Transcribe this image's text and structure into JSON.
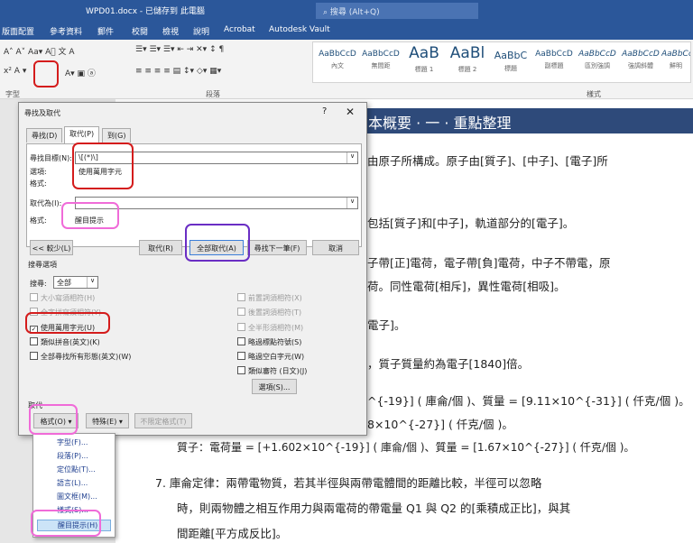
{
  "titlebar": {
    "document": "WPD01.docx - 已儲存到 此電腦",
    "search_placeholder": "搜尋 (Alt+Q)"
  },
  "menu_tabs": [
    "版面配置",
    "參考資料",
    "郵件",
    "校閱",
    "檢視",
    "說明",
    "Acrobat",
    "Autodesk Vault"
  ],
  "ribbon": {
    "font_group": "字型",
    "paragraph_group": "段落",
    "styles_group": "樣式",
    "styles": [
      {
        "preview": "AaBbCcD",
        "name": "內文"
      },
      {
        "preview": "AaBbCcD",
        "name": "無間距"
      },
      {
        "preview": "AaB",
        "name": "標題 1"
      },
      {
        "preview": "AaBl",
        "name": "標題 2"
      },
      {
        "preview": "AaBbC",
        "name": "標題"
      },
      {
        "preview": "AaBbCcD",
        "name": "副標題"
      },
      {
        "preview": "AaBbCcD",
        "name": "區別強調"
      },
      {
        "preview": "AaBbCcD",
        "name": "強調斜體"
      },
      {
        "preview": "AaBbCcD",
        "name": "鮮明"
      }
    ]
  },
  "document": {
    "banner": "本概要 · 一 · 重點整理",
    "lines": [
      "由原子所構成。原子由[質子]、[中子]、[電子]所",
      "包括[質子]和[中子]，軌道部分的[電子]。",
      "子帶[正]電荷，電子帶[負]電荷，中子不帶電，原",
      "荷。同性電荷[相斥]，異性電荷[相吸]。",
      "電子]。",
      "，質子質量約為電子[1840]倍。",
      "^{-19}] ( 庫侖/個 )、質量 = [9.11×10^{-31}] ( 仟克/個 )。",
      "8×10^{-27}] ( 仟克/個 )。",
      "質子：電荷量 = [+1.602×10^{-19}] ( 庫侖/個 )、質量 = [1.67×10^{-27}] ( 仟克/個 )。",
      "7. 庫侖定律：兩帶電物質，若其半徑與兩帶電體間的距離比較，半徑可以忽略",
      "時，則兩物體之相互作用力與兩電荷的帶電量 Q1 與 Q2 的[乘積成正比]，與其",
      "間距離[平方成反比]。"
    ]
  },
  "dialog": {
    "title": "尋找及取代",
    "help": "?",
    "close": "✕",
    "tabs": [
      "尋找(D)",
      "取代(P)",
      "到(G)"
    ],
    "find_label": "尋找目標(N):",
    "find_value": "\\[(*)\\]",
    "options_label": "選項:",
    "options_value": "使用萬用字元",
    "format_label": "格式:",
    "replace_label": "取代為(I):",
    "replace_value": "",
    "replace_format_label": "格式:",
    "replace_format_value": "醒目提示",
    "buttons": {
      "less": "<< 較少(L)",
      "replace": "取代(R)",
      "replace_all": "全部取代(A)",
      "find_next": "尋找下一筆(F)",
      "cancel": "取消"
    },
    "search_options": "搜尋選項",
    "search_label": "搜尋:",
    "search_value": "全部",
    "left_checks": [
      {
        "label": "大小寫須相符(H)",
        "checked": false,
        "disabled": true
      },
      {
        "label": "全字拼寫須相符(Y)",
        "checked": false,
        "disabled": true
      },
      {
        "label": "使用萬用字元(U)",
        "checked": true,
        "disabled": false
      },
      {
        "label": "類似拼音(英文)(K)",
        "checked": false,
        "disabled": false
      },
      {
        "label": "全部尋找所有形態(英文)(W)",
        "checked": false,
        "disabled": false
      }
    ],
    "right_checks": [
      {
        "label": "前置詞須相符(X)",
        "checked": false,
        "disabled": true
      },
      {
        "label": "後置詞須相符(T)",
        "checked": false,
        "disabled": true
      },
      {
        "label": "全半形須相符(M)",
        "checked": false,
        "disabled": true
      },
      {
        "label": "略過標點符號(S)",
        "checked": false,
        "disabled": false
      },
      {
        "label": "略過空白字元(W)",
        "checked": false,
        "disabled": false
      },
      {
        "label": "類似審符 (日文)(J)",
        "checked": false,
        "disabled": false
      }
    ],
    "options_button": "選項(S)...",
    "replace_section": "取代",
    "format_button": "格式(O) ▾",
    "special_button": "特殊(E) ▾",
    "no_format_button": "不限定格式(T)"
  },
  "format_menu": [
    "字型(F)...",
    "段落(P)...",
    "定位點(T)...",
    "語言(L)...",
    "圖文框(M)...",
    "樣式(S)...",
    "醒目提示(H)"
  ]
}
